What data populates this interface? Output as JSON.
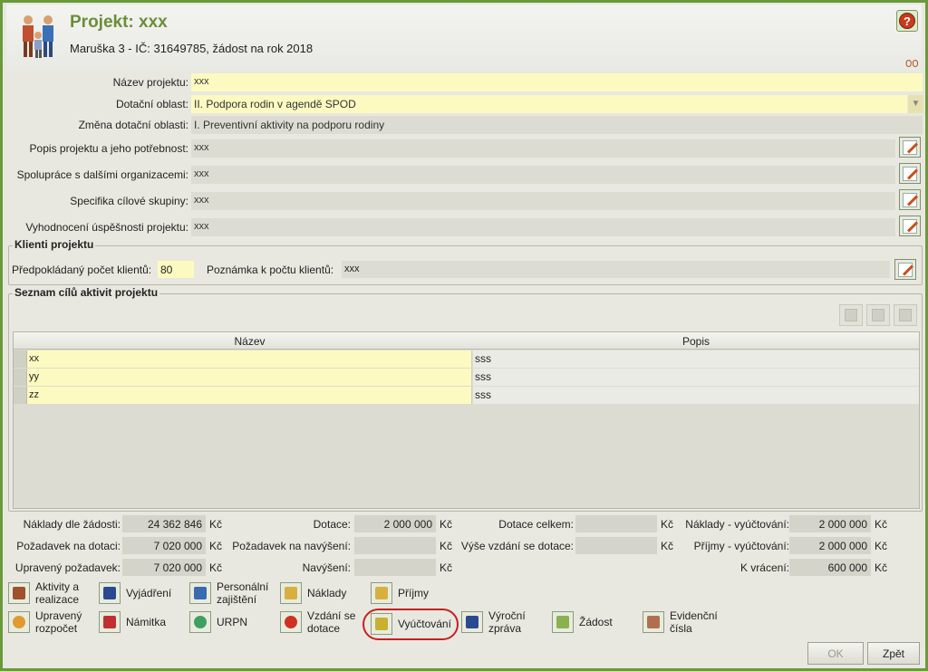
{
  "header": {
    "title": "Projekt: xxx",
    "subtitle": "Maruška 3 - IČ: 31649785, žádost na rok 2018"
  },
  "form": {
    "nazev_label": "Název projektu:",
    "nazev_value": "xxx",
    "oblast_label": "Dotační oblast:",
    "oblast_value": "II. Podpora rodin v agendě SPOD",
    "zmena_label": "Změna dotační oblasti:",
    "zmena_value": "I. Preventivní aktivity na podporu rodiny",
    "popis_label": "Popis projektu a jeho potřebnost:",
    "popis_value": "xxx",
    "spoluprace_label": "Spolupráce s dalšími organizacemi:",
    "spoluprace_value": "xxx",
    "specifika_label": "Specifika cílové skupiny:",
    "specifika_value": "xxx",
    "vyhodnoceni_label": "Vyhodnocení úspěšnosti projektu:",
    "vyhodnoceni_value": "xxx"
  },
  "klienti": {
    "title": "Klienti projektu",
    "pocet_label": "Předpokládaný počet klientů:",
    "pocet_value": "80",
    "poznamka_label": "Poznámka k počtu klientů:",
    "poznamka_value": "xxx"
  },
  "cile": {
    "title": "Seznam cílů aktivit projektu",
    "columns": [
      "Název",
      "Popis"
    ],
    "rows": [
      {
        "nazev": "xx",
        "popis": "sss"
      },
      {
        "nazev": "yy",
        "popis": "sss"
      },
      {
        "nazev": "zz",
        "popis": "sss"
      }
    ]
  },
  "summary": {
    "naklady_label": "Náklady dle žádosti:",
    "naklady_value": "24 362 846",
    "pozadavek_label": "Požadavek na dotaci:",
    "pozadavek_value": "7 020 000",
    "upraveny_label": "Upravený požadavek:",
    "upraveny_value": "7 020 000",
    "dotace_label": "Dotace:",
    "dotace_value": "2 000 000",
    "pozadavek_navyseni_label": "Požadavek na navýšení:",
    "pozadavek_navyseni_value": "",
    "navyseni_label": "Navýšení:",
    "navyseni_value": "",
    "dotace_celkem_label": "Dotace celkem:",
    "dotace_celkem_value": "",
    "vyse_vzdani_label": "Výše vzdání se dotace:",
    "vyse_vzdani_value": "",
    "naklady_vyuct_label": "Náklady - vyúčtování:",
    "naklady_vyuct_value": "2 000 000",
    "prijmy_vyuct_label": "Příjmy - vyúčtování:",
    "prijmy_vyuct_value": "2 000 000",
    "k_vraceni_label": "K vrácení:",
    "k_vraceni_value": "600 000",
    "currency": "Kč"
  },
  "actions": {
    "aktivity_1": "Aktivity a",
    "aktivity_2": "realizace",
    "vyjadreni": "Vyjádření",
    "personalni_1": "Personální",
    "personalni_2": "zajištění",
    "naklady": "Náklady",
    "prijmy": "Příjmy",
    "rozpocet_1": "Upravený",
    "rozpocet_2": "rozpočet",
    "namitka": "Námitka",
    "urpn": "URPN",
    "vzdani_1": "Vzdání se",
    "vzdani_2": "dotace",
    "vyuctovani": "Vyúčtování",
    "vyrocni_1": "Výroční",
    "vyrocni_2": "zpráva",
    "zadost": "Žádost",
    "evidencni_1": "Evidenční",
    "evidencni_2": "čísla"
  },
  "buttons": {
    "ok": "OK",
    "zpet": "Zpět"
  }
}
